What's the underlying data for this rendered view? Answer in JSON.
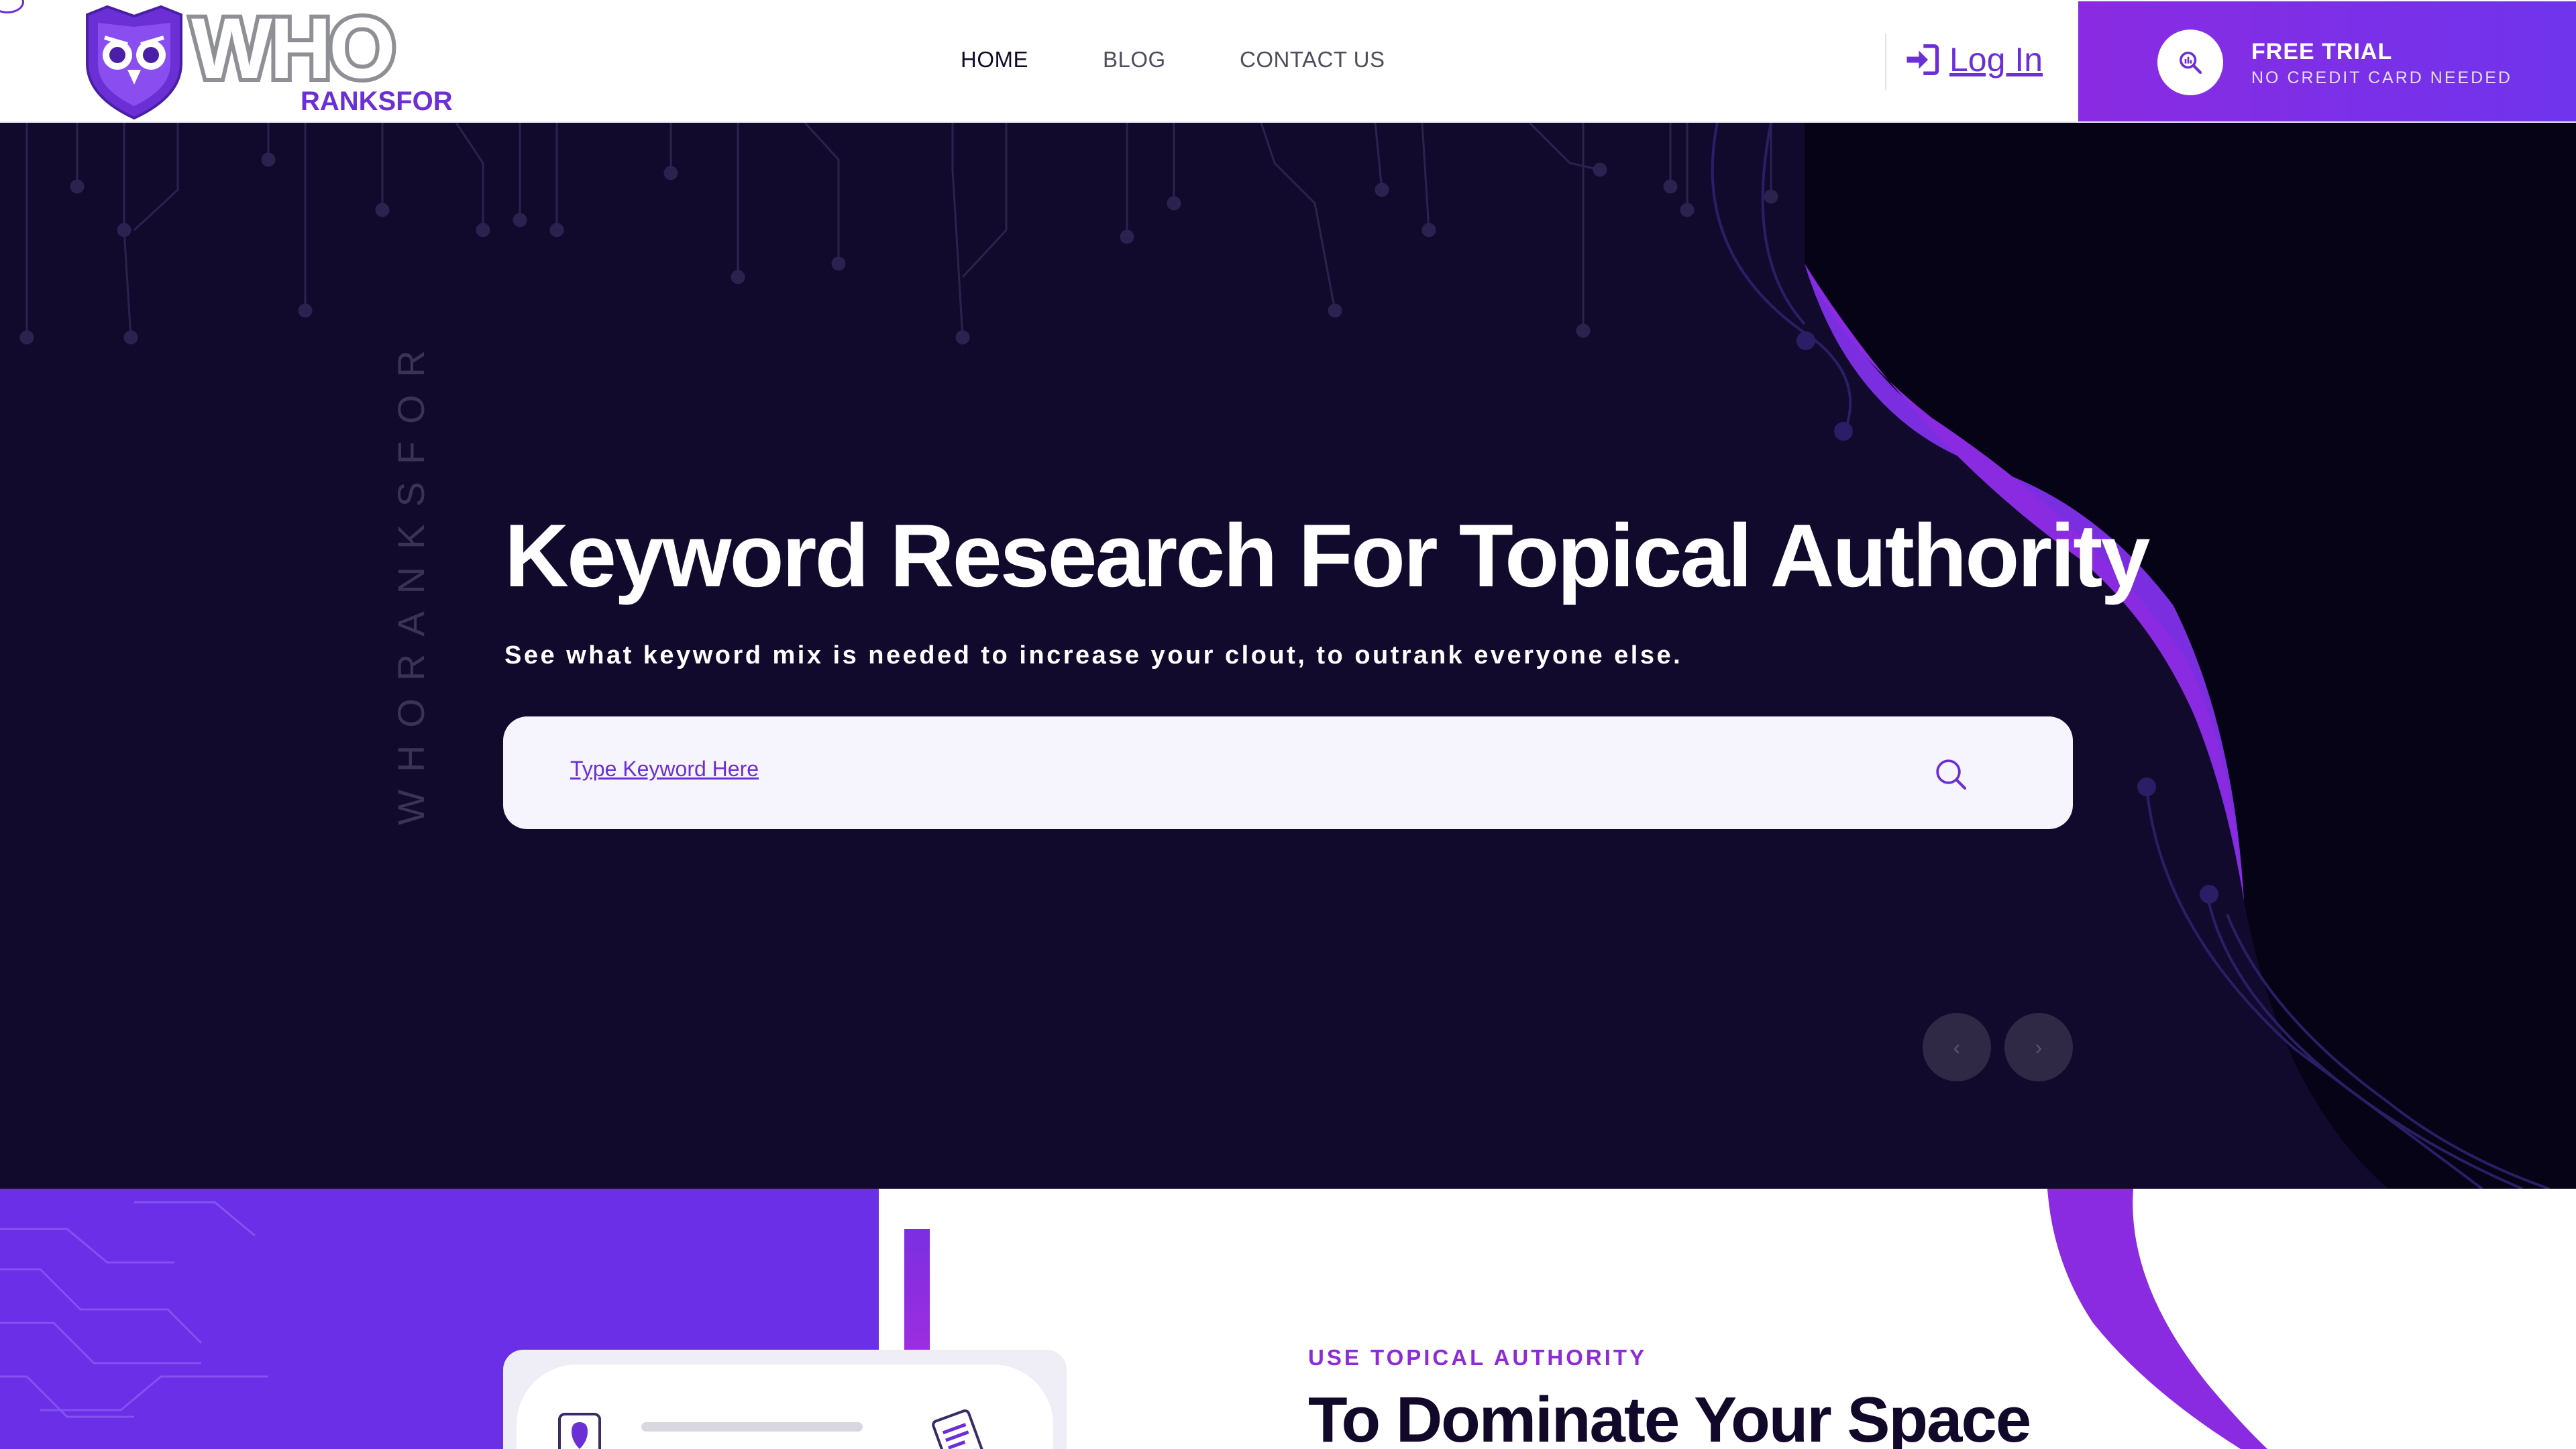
{
  "brand": {
    "logo_wordmark": "WHO",
    "logo_subtext": "RANKSFOR"
  },
  "nav": {
    "items": [
      {
        "label": "HOME",
        "active": true
      },
      {
        "label": "BLOG",
        "active": false
      },
      {
        "label": "CONTACT US",
        "active": false
      }
    ],
    "login_label": "Log In",
    "trial": {
      "title": "FREE TRIAL",
      "subtitle": "NO CREDIT CARD NEEDED"
    }
  },
  "hero": {
    "vertical_text": "WHORANKSFOR",
    "title": "Keyword Research For Topical Authority",
    "subtitle": "See what keyword mix is needed to increase your clout, to outrank everyone else.",
    "search_placeholder": "Type Keyword Here",
    "prev_arrow": "‹",
    "next_arrow": "›"
  },
  "section": {
    "eyebrow": "USE TOPICAL AUTHORITY",
    "title": "To Dominate Your Space"
  },
  "colors": {
    "accent": "#6b2fe8",
    "accent_magenta": "#8a2be2",
    "hero_bg": "#120a2c",
    "text_dark": "#12082a"
  },
  "icons": [
    "login-icon",
    "search-icon",
    "owl-shield-icon",
    "chevron-left-icon",
    "chevron-right-icon"
  ]
}
